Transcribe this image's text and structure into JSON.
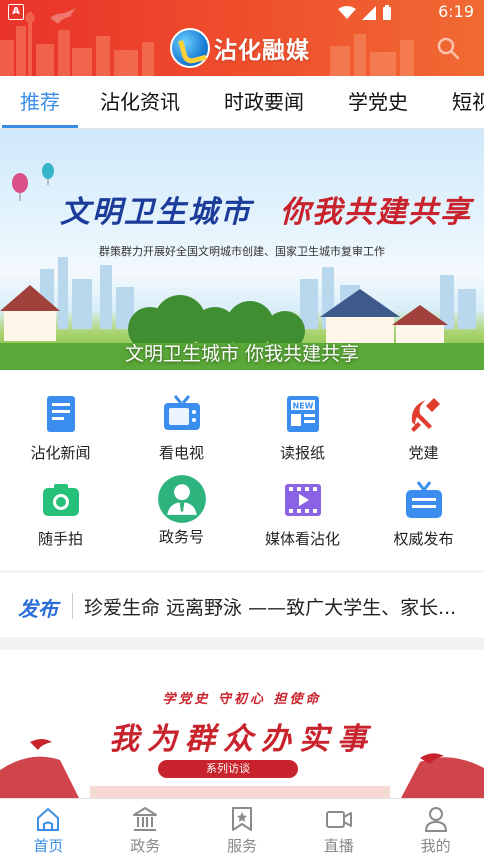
{
  "status_bar": {
    "time": "6:19"
  },
  "header": {
    "app_name": "沾化融媒"
  },
  "tabs": [
    {
      "label": "推荐",
      "active": true
    },
    {
      "label": "沾化资讯",
      "active": false
    },
    {
      "label": "时政要闻",
      "active": false
    },
    {
      "label": "学党史",
      "active": false
    },
    {
      "label": "短视",
      "active": false
    }
  ],
  "banner": {
    "headline_left": "文明卫生城市",
    "headline_right": "你我共建共享",
    "subtitle": "群策群力开展好全国文明城市创建、国家卫生城市复审工作",
    "caption": "文明卫生城市 你我共建共享"
  },
  "grid": [
    {
      "label": "沾化新闻",
      "icon": "newspaper-icon"
    },
    {
      "label": "看电视",
      "icon": "tv-icon"
    },
    {
      "label": "读报纸",
      "icon": "news-paper-icon"
    },
    {
      "label": "党建",
      "icon": "party-emblem-icon"
    },
    {
      "label": "随手拍",
      "icon": "camera-icon"
    },
    {
      "label": "政务号",
      "icon": "official-account-icon"
    },
    {
      "label": "媒体看沾化",
      "icon": "video-icon"
    },
    {
      "label": "权威发布",
      "icon": "broadcast-icon"
    }
  ],
  "ticker": {
    "tag": "发布",
    "text": "珍爱生命 远离野泳 ——致广大学生、家长..."
  },
  "promo": {
    "kicker": "学党史 守初心 担使命",
    "title": "我为群众办实事",
    "badge": "系列访谈"
  },
  "bottom_nav": [
    {
      "label": "首页",
      "active": true
    },
    {
      "label": "政务",
      "active": false
    },
    {
      "label": "服务",
      "active": false
    },
    {
      "label": "直播",
      "active": false
    },
    {
      "label": "我的",
      "active": false
    }
  ],
  "colors": {
    "accent": "#3a8ee6",
    "header_red": "#e8322a",
    "party_red": "#c8232c"
  }
}
